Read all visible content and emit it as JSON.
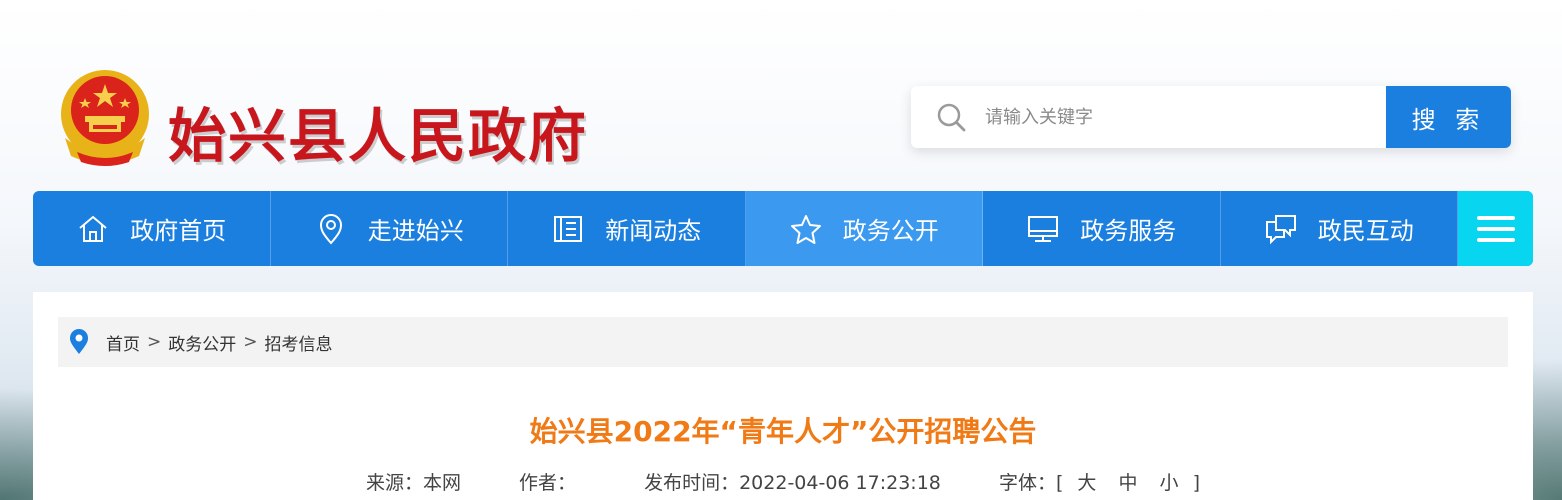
{
  "header": {
    "site_title": "始兴县人民政府",
    "logo_icon": "national-emblem-icon"
  },
  "search": {
    "placeholder": "请输入关键字",
    "button_label": "搜 索",
    "icon": "search-icon"
  },
  "nav": {
    "items": [
      {
        "label": "政府首页",
        "icon": "home-icon"
      },
      {
        "label": "走进始兴",
        "icon": "location-pin-icon"
      },
      {
        "label": "新闻动态",
        "icon": "news-icon"
      },
      {
        "label": "政务公开",
        "icon": "star-icon",
        "active": true
      },
      {
        "label": "政务服务",
        "icon": "monitor-icon"
      },
      {
        "label": "政民互动",
        "icon": "chat-icon"
      }
    ],
    "menu_icon": "hamburger-menu-icon"
  },
  "breadcrumb": {
    "items": [
      "首页",
      "政务公开",
      "招考信息"
    ],
    "separator": ">"
  },
  "article": {
    "title": "始兴县2022年“青年人才”公开招聘公告",
    "source_label": "来源：本网",
    "author_label": "作者：",
    "publish_label": "发布时间：2022-04-06 17:23:18",
    "font_label": "字体：[",
    "font_large": "大",
    "font_medium": "中",
    "font_small": "小",
    "font_close": "]"
  },
  "colors": {
    "brand_red": "#c8161d",
    "nav_blue": "#1b7fe0",
    "nav_active": "#3b9af0",
    "menu_cyan": "#08d6f0",
    "title_orange": "#f07a16"
  }
}
